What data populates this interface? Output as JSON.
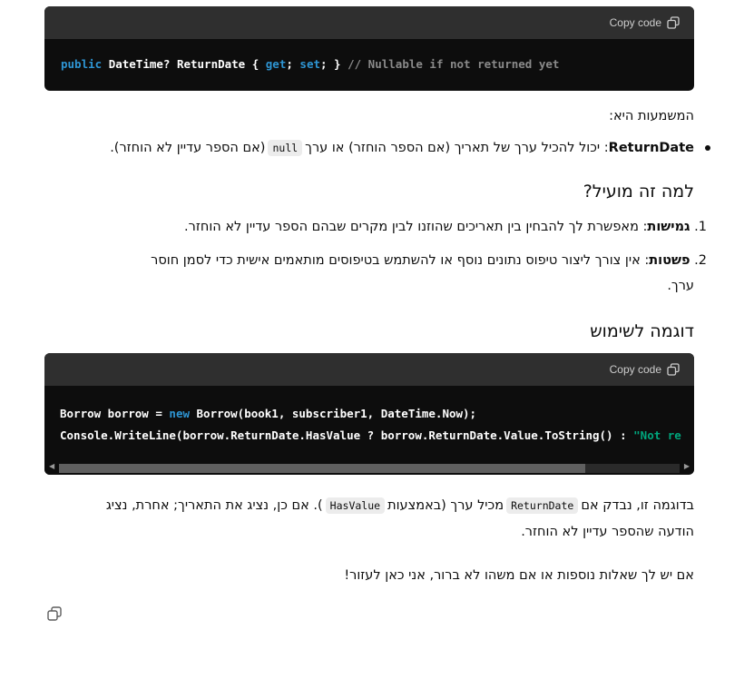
{
  "code_block_1": {
    "copy_label": "Copy code",
    "kw_public": "public",
    "type_part": "DateTime? ReturnDate { ",
    "kw_get": "get",
    "semi1": "; ",
    "kw_set": "set",
    "semi2": "; } ",
    "comment": "// Nullable if not returned yet"
  },
  "meaning_intro": "המשמעות היא:",
  "bullet": {
    "term": "ReturnDate",
    "text_before": ": יכול להכיל ערך של תאריך (אם הספר הוחזר) או ערך",
    "code": "null",
    "text_after": "(אם הספר עדיין לא הוחזר)."
  },
  "heading_useful": "למה זה מועיל?",
  "list": [
    {
      "num": "1.",
      "term": "גמישות",
      "text": ": מאפשרת לך להבחין בין תאריכים שהוזנו לבין מקרים שבהם הספר עדיין לא הוחזר."
    },
    {
      "num": "2.",
      "term": "פשטות",
      "text": ": אין צורך ליצור טיפוס נתונים נוסף או להשתמש בטיפוסים מותאמים אישית כדי לסמן חוסר",
      "text2": "ערך."
    }
  ],
  "heading_example": "דוגמה לשימוש",
  "code_block_2": {
    "copy_label": "Copy code",
    "l1_a": "Borrow borrow = ",
    "l1_kw": "new",
    "l1_b": " Borrow(book1, subscriber1, DateTime.Now);",
    "l2_a": "Console.WriteLine(borrow.ReturnDate.HasValue ? borrow.ReturnDate.Value.ToString() : ",
    "l2_str": "\"Not re"
  },
  "explanation": {
    "p1": "בדוגמה זו, נבדק אם",
    "code1": "ReturnDate",
    "p2": "מכיל ערך (באמצעות",
    "code2": "HasValue",
    "p3": "). אם כן, נציג את התאריך; אחרת, נציג",
    "line2": "הודעה שהספר עדיין לא הוחזר."
  },
  "closing": "אם יש לך שאלות נוספות או אם משהו לא ברור, אני כאן לעזור!",
  "icons": {
    "copy": "copy-icon",
    "message_copy": "copy-icon"
  }
}
